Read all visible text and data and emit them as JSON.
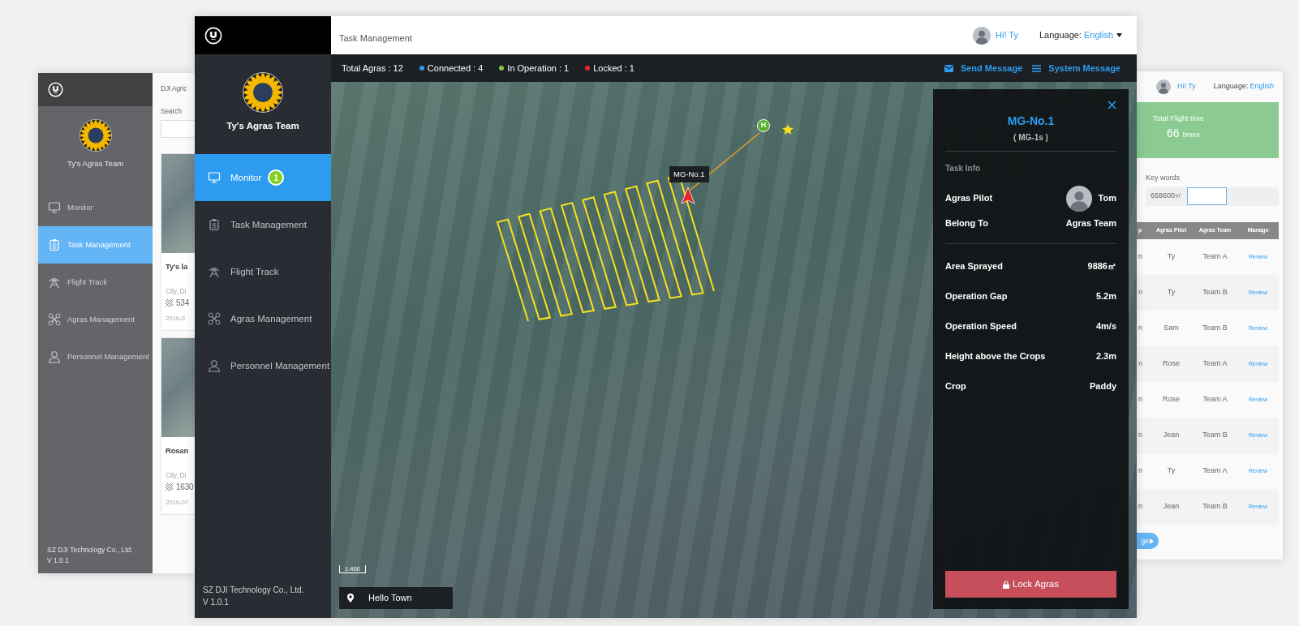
{
  "back_left_window": {
    "team_name": "Ty's Agras Team",
    "nav": [
      {
        "label": "Monitor",
        "selected": false
      },
      {
        "label": "Task Management",
        "selected": true
      },
      {
        "label": "Flight Track",
        "selected": false
      },
      {
        "label": "Agras Management",
        "selected": false
      },
      {
        "label": "Personnel Management",
        "selected": false
      }
    ],
    "footer": [
      "SZ DJI Technology Co., Ltd.",
      "V 1.0.1"
    ],
    "content": {
      "breadcrumb": "DJI Agric",
      "search_label": "Search",
      "cards": [
        {
          "title": "Ty's la",
          "location": "City, Di",
          "area": "534",
          "date": "2016-0"
        },
        {
          "title": "Rosan",
          "location": "City, Di",
          "area": "1630",
          "date": "2016-07"
        }
      ]
    }
  },
  "back_right_window": {
    "greeting": "Hi! Ty",
    "language_label": "Language:",
    "language": "English",
    "stat": {
      "label": "Total Flight time",
      "value": "66",
      "unit": "times"
    },
    "keywords_label": "Key words",
    "keywords_value": "658600㎡",
    "table": {
      "columns": [
        "p",
        "Agras Pilot",
        "Agras Team",
        "Manage"
      ],
      "rows": [
        {
          "column_1": "n",
          "pilot": "Ty",
          "team": "Team A",
          "action": "Review"
        },
        {
          "column_1": "n",
          "pilot": "Ty",
          "team": "Team B",
          "action": "Review"
        },
        {
          "column_1": "n",
          "pilot": "Sam",
          "team": "Team B",
          "action": "Review"
        },
        {
          "column_1": "n",
          "pilot": "Rose",
          "team": "Team A",
          "action": "Review"
        },
        {
          "column_1": "n",
          "pilot": "Rose",
          "team": "Team A",
          "action": "Review"
        },
        {
          "column_1": "n",
          "pilot": "Jean",
          "team": "Team B",
          "action": "Review"
        },
        {
          "column_1": "n",
          "pilot": "Ty",
          "team": "Team A",
          "action": "Review"
        },
        {
          "column_1": "n",
          "pilot": "Jean",
          "team": "Team B",
          "action": "Review"
        }
      ]
    },
    "page_button": "ge"
  },
  "front_window": {
    "sidebar": {
      "team_name": "Ty's Agras Team",
      "nav": [
        {
          "label": "Monitor",
          "selected": true,
          "badge": "1"
        },
        {
          "label": "Task Management",
          "selected": false
        },
        {
          "label": "Flight Track",
          "selected": false
        },
        {
          "label": "Agras Management",
          "selected": false
        },
        {
          "label": "Personnel Management",
          "selected": false
        }
      ],
      "footer": [
        "SZ DJI Technology Co., Ltd.",
        "V 1.0.1"
      ]
    },
    "header": {
      "breadcrumb": "Task Management",
      "greeting": "Hi! Ty",
      "language_label": "Language:",
      "language": "English"
    },
    "status_bar": {
      "total": "Total Agras : 12",
      "counts": [
        {
          "label": "Connected : 4",
          "color": "#2f9bf0"
        },
        {
          "label": "In Operation : 1",
          "color": "#8cc63f"
        },
        {
          "label": "Locked : 1",
          "color": "#e8232a"
        }
      ],
      "actions": [
        "Send Message",
        "System Message"
      ]
    },
    "map": {
      "marker_label": "MG-No.1",
      "home_marker": "H",
      "scale": "1:400",
      "location": "Hello Town"
    },
    "detail_panel": {
      "title": "MG-No.1",
      "model": "( MG-1s )",
      "section": "Task Info",
      "people": [
        {
          "label": "Agras Pilot",
          "value": "Tom",
          "kind": "avatar"
        },
        {
          "label": "Belong To",
          "value": "Agras Team",
          "kind": "text"
        }
      ],
      "stats": [
        {
          "label": "Area Sprayed",
          "value": "9886㎡"
        },
        {
          "label": "Operation Gap",
          "value": "5.2m"
        },
        {
          "label": "Operation Speed",
          "value": "4m/s"
        },
        {
          "label": "Height above the Crops",
          "value": "2.3m"
        },
        {
          "label": "Crop",
          "value": "Paddy"
        }
      ],
      "button": "Lock Agras"
    }
  }
}
